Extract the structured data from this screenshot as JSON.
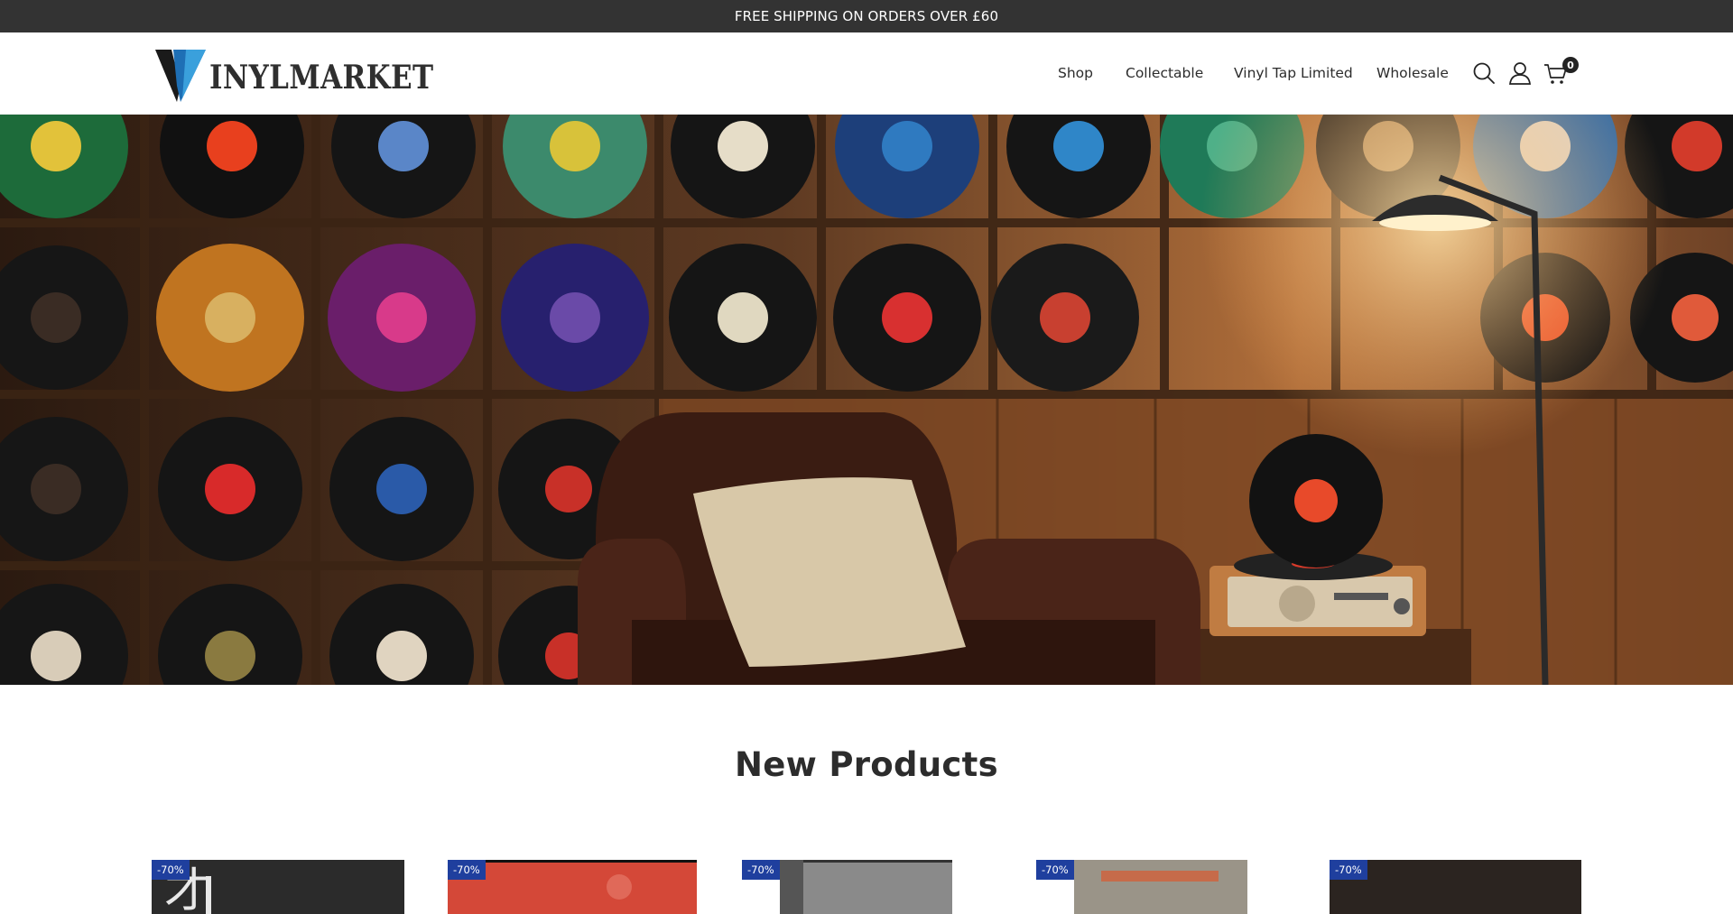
{
  "announcement": "FREE SHIPPING ON ORDERS OVER £60",
  "brand": {
    "logo_text": "INYLMARKET",
    "logo_colors": [
      "#1e5fa8",
      "#3a9bd6",
      "#1a1a1a"
    ]
  },
  "nav": {
    "items": [
      {
        "label": "Shop"
      },
      {
        "label": "Collectable"
      },
      {
        "label": "Vinyl Tap Limited"
      },
      {
        "label": "Wholesale"
      }
    ],
    "icons": [
      "search-icon",
      "user-icon",
      "cart-icon"
    ],
    "cart_count": "0"
  },
  "hero": {
    "alt_colors": [
      "#3a2416",
      "#b8743e"
    ]
  },
  "section": {
    "title": "New Products"
  },
  "products": [
    {
      "badge": "-70%",
      "thumb_color": "#2a2a2a"
    },
    {
      "badge": "-70%",
      "thumb_color": "#d8493a"
    },
    {
      "badge": "-70%",
      "thumb_color": "#6b6b6b"
    },
    {
      "badge": "-70%",
      "thumb_color": "#8a8a80"
    },
    {
      "badge": "-70%",
      "thumb_color": "#2b2420"
    }
  ],
  "colors": {
    "announce_bg": "#333333",
    "badge_bg": "#1f3f9e"
  }
}
